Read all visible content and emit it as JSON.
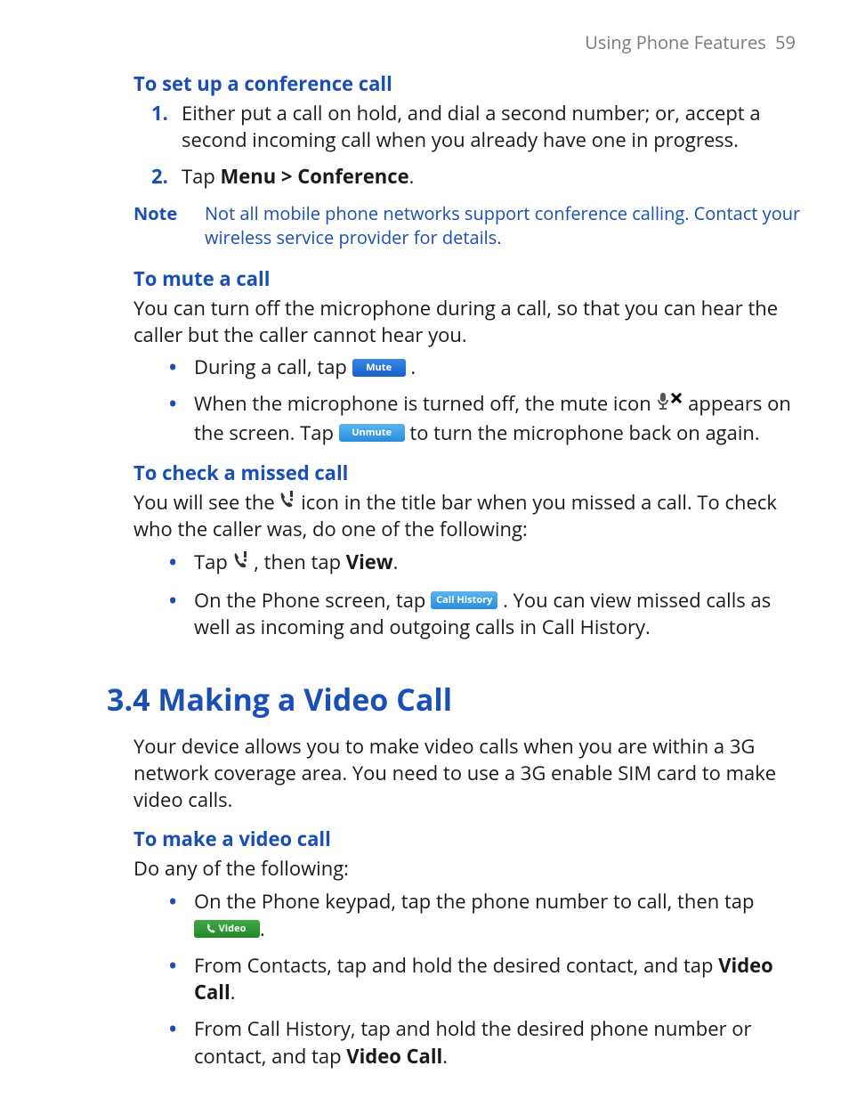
{
  "running_head": {
    "title": "Using Phone Features",
    "page": "59"
  },
  "conf": {
    "heading": "To set up a conference call",
    "step1": "Either put a call on hold, and dial a second number; or, accept a second incoming call when you already have one in progress.",
    "step2_prefix": "Tap ",
    "step2_bold": "Menu > Conference",
    "step2_suffix": "."
  },
  "note": {
    "label": "Note",
    "body": "Not all mobile phone networks support conference calling. Contact your wireless service provider for details."
  },
  "mute": {
    "heading": "To mute a call",
    "intro": "You can turn off the microphone during a call, so that you can hear the caller but the caller cannot hear you.",
    "b1_prefix": "During a call, tap  ",
    "b1_chip": "Mute",
    "b1_suffix": ".",
    "b2_prefix": "When the microphone is turned off, the mute icon ",
    "b2_mid": " appears on the screen. Tap  ",
    "b2_chip": "Unmute",
    "b2_suffix": "  to turn the microphone back on again."
  },
  "missed": {
    "heading": "To check a missed call",
    "intro_prefix": "You will see the  ",
    "intro_suffix": "  icon in the title bar when you missed a call. To check who the caller was, do one of the following:",
    "b1_prefix": "Tap  ",
    "b1_mid": " , then tap ",
    "b1_bold": "View",
    "b1_suffix": ".",
    "b2_prefix": "On the Phone screen, tap  ",
    "b2_chip": "Call History",
    "b2_suffix": ". You can view missed calls as well as incoming and outgoing calls in Call History."
  },
  "section": {
    "title": "3.4  Making a Video Call",
    "intro": "Your device allows you to make video calls when you are within a 3G network coverage area. You need to use a 3G enable SIM card to make video calls."
  },
  "make": {
    "heading": "To make a video call",
    "intro": "Do any of the following:",
    "b1_prefix": "On the Phone keypad, tap the phone number to call, then tap ",
    "b1_chip": "Video",
    "b1_suffix": ".",
    "b2_prefix": "From Contacts, tap and hold the desired contact, and tap ",
    "b2_bold": "Video Call",
    "b2_suffix": ".",
    "b3_prefix": "From Call History, tap and hold the desired phone number or contact, and tap ",
    "b3_bold": "Video Call",
    "b3_suffix": "."
  }
}
